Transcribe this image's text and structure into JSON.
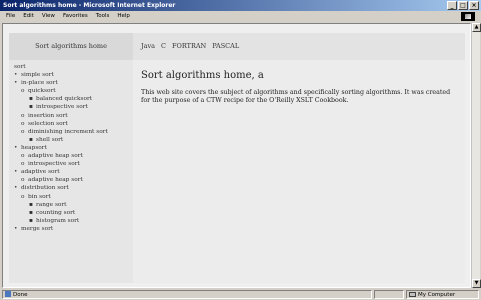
{
  "window": {
    "title": "Sort algorithms home - Microsoft Internet Explorer"
  },
  "menu": [
    "File",
    "Edit",
    "View",
    "Favorites",
    "Tools",
    "Help"
  ],
  "menu_underline": [
    "F",
    "E",
    "V",
    "a",
    "T",
    "H"
  ],
  "page": {
    "sidebar_heading": "Sort algorithms home",
    "top_links": [
      "Java",
      "C",
      "FORTRAN",
      "PASCAL"
    ],
    "title": "Sort algorithms home, a",
    "body": "This web site covers the subject of algorithms and specifically sorting algorithms. It was created for the purpose of a CTW recipe for the O'Reilly XSLT Cookbook."
  },
  "tree": [
    {
      "label": "sort",
      "level": 0,
      "bullet": ""
    },
    {
      "label": "simple sort",
      "level": 1,
      "bullet": "•"
    },
    {
      "label": "in-place sort",
      "level": 1,
      "bullet": "•"
    },
    {
      "label": "quicksort",
      "level": 2,
      "bullet": "o"
    },
    {
      "label": "balanced quicksort",
      "level": 3,
      "bullet": "▪"
    },
    {
      "label": "introspective sort",
      "level": 3,
      "bullet": "▪"
    },
    {
      "label": "insertion sort",
      "level": 2,
      "bullet": "o"
    },
    {
      "label": "selection sort",
      "level": 2,
      "bullet": "o"
    },
    {
      "label": "diminishing increment sort",
      "level": 2,
      "bullet": "o"
    },
    {
      "label": "shell sort",
      "level": 3,
      "bullet": "▪"
    },
    {
      "label": "heapsort",
      "level": 1,
      "bullet": "•"
    },
    {
      "label": "adaptive heap sort",
      "level": 2,
      "bullet": "o"
    },
    {
      "label": "introspective sort",
      "level": 2,
      "bullet": "o"
    },
    {
      "label": "adaptive sort",
      "level": 1,
      "bullet": "•"
    },
    {
      "label": "adaptive heap sort",
      "level": 2,
      "bullet": "o"
    },
    {
      "label": "distribution sort",
      "level": 1,
      "bullet": "•"
    },
    {
      "label": "bin sort",
      "level": 2,
      "bullet": "o"
    },
    {
      "label": "range sort",
      "level": 3,
      "bullet": "▪"
    },
    {
      "label": "counting sort",
      "level": 3,
      "bullet": "▪"
    },
    {
      "label": "histogram sort",
      "level": 3,
      "bullet": "▪"
    },
    {
      "label": "merge sort",
      "level": 1,
      "bullet": "•"
    }
  ],
  "status": {
    "left": "Done",
    "zone": "My Computer"
  }
}
